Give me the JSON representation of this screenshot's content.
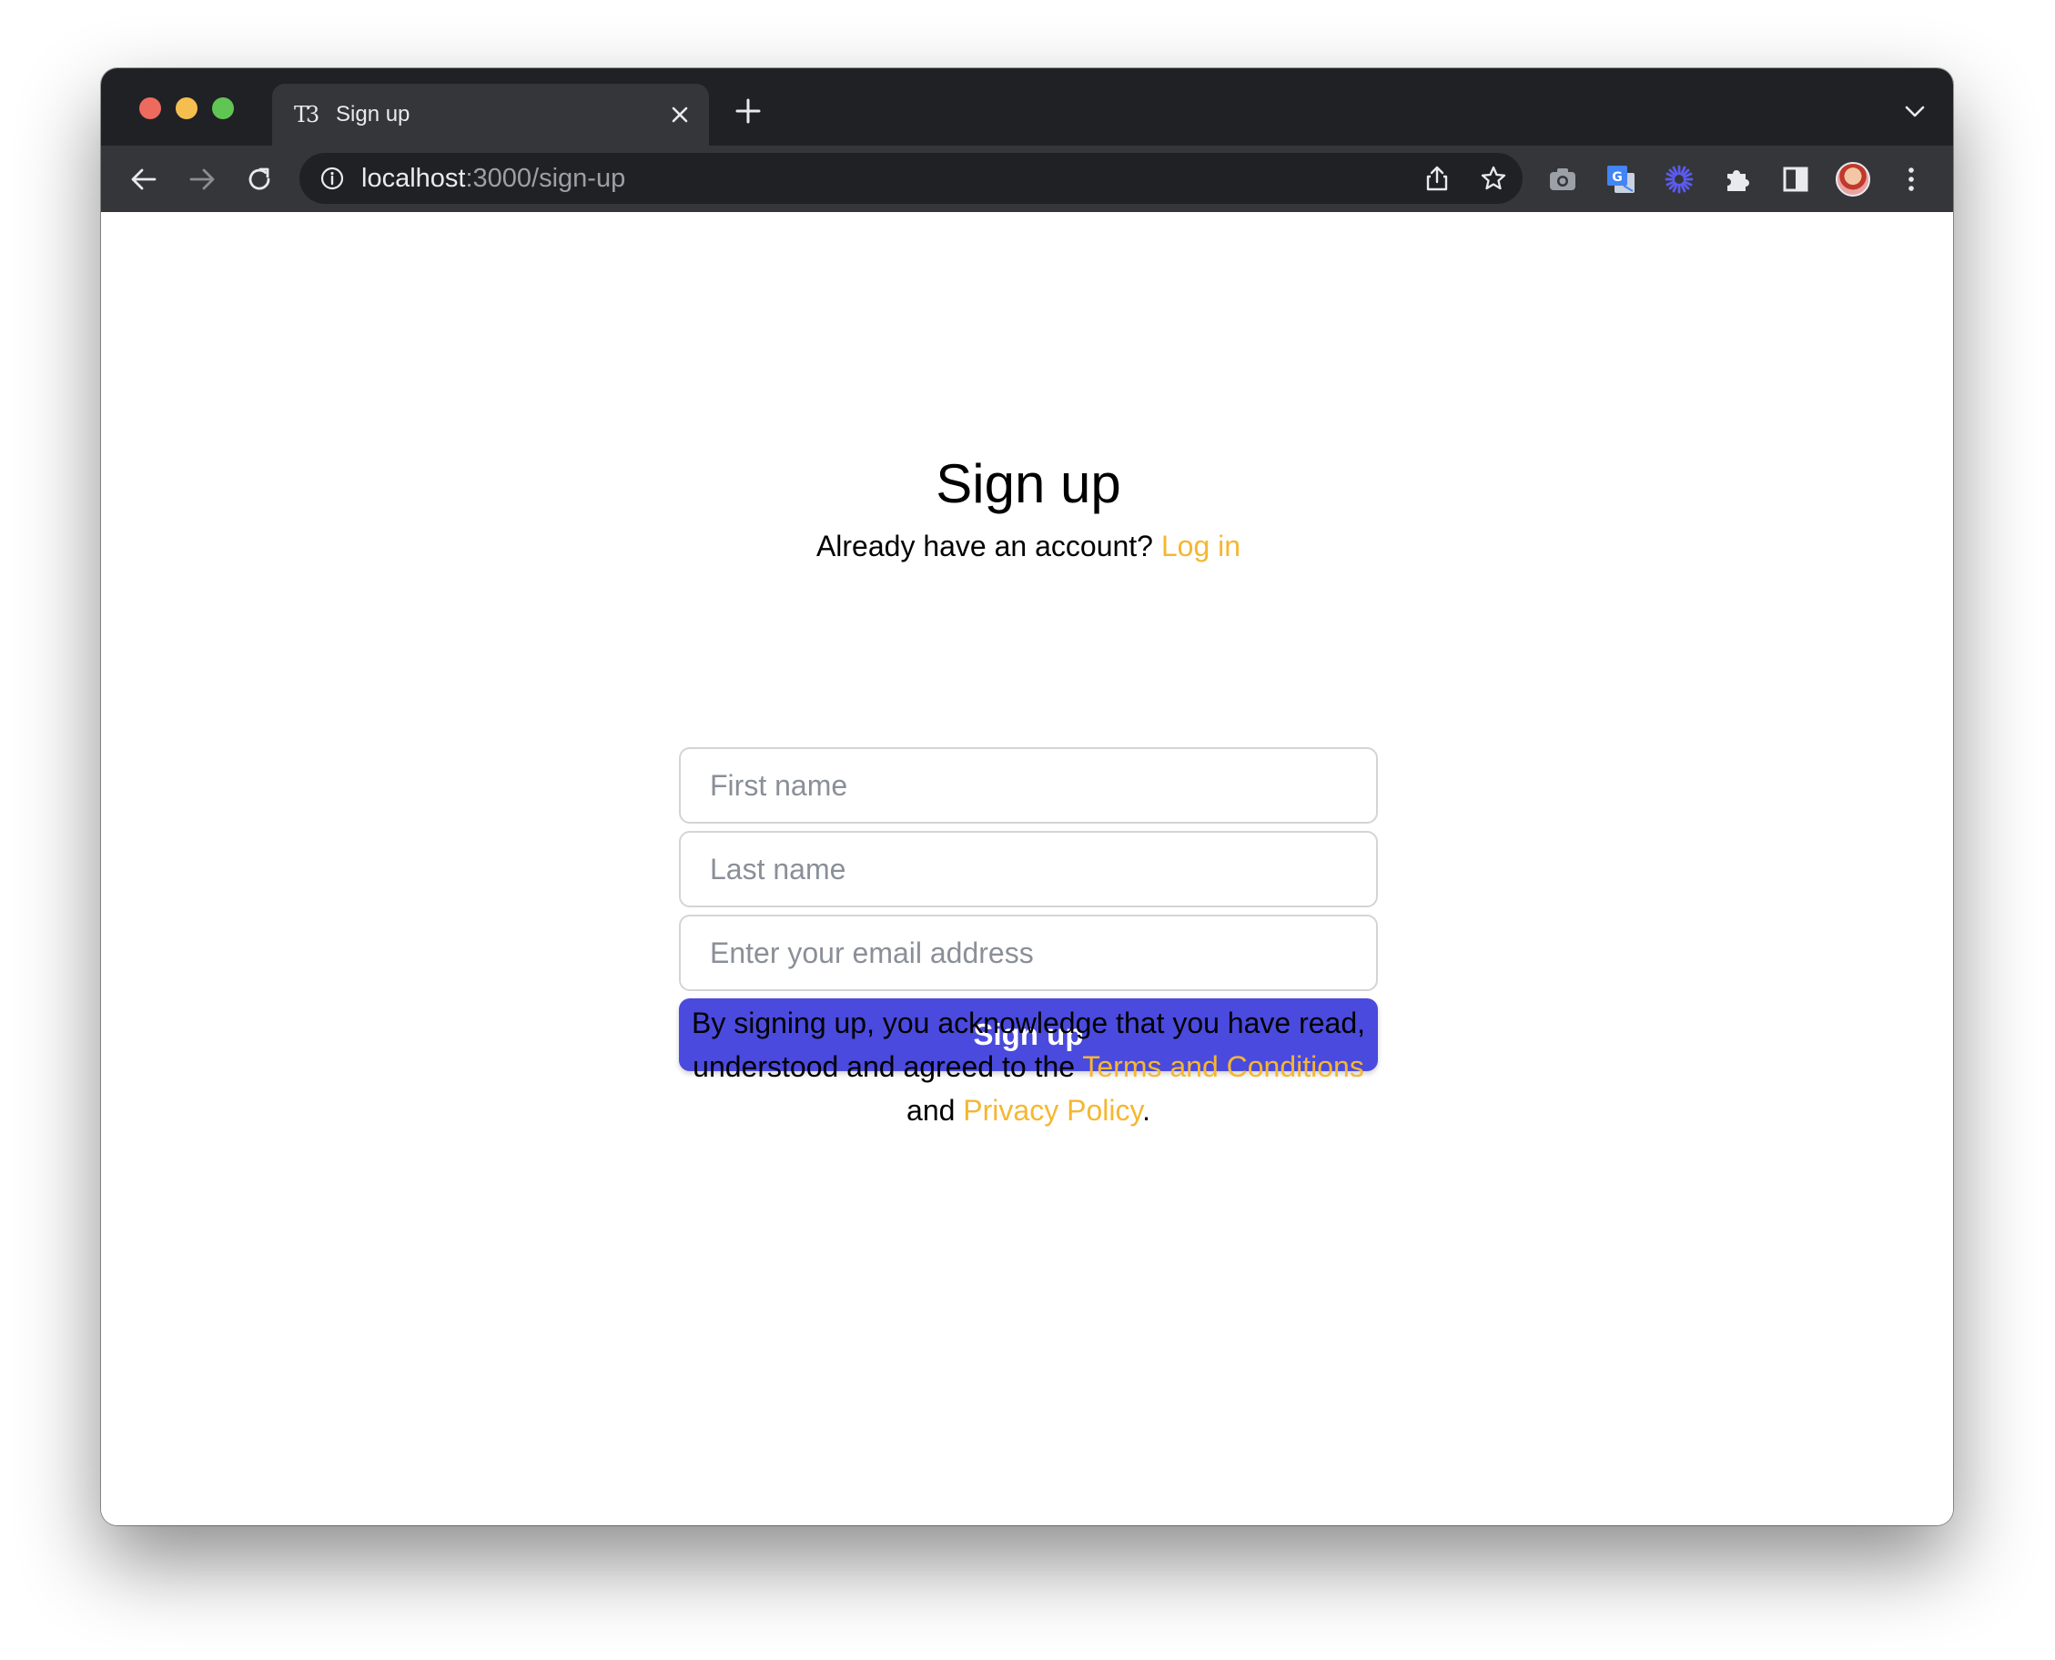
{
  "browser": {
    "tab_title": "Sign up",
    "tab_favicon": "T3",
    "url_host": "localhost",
    "url_path": ":3000/sign-up",
    "icons": [
      "back-arrow-icon",
      "forward-arrow-icon",
      "reload-icon",
      "info-icon",
      "share-icon",
      "star-icon",
      "camera-icon",
      "translate-icon",
      "snowflake-icon",
      "puzzle-icon",
      "side-panel-icon",
      "menu-dots-icon"
    ]
  },
  "page": {
    "heading": "Sign up",
    "subtext_prefix": "Already have an account?",
    "login_link": "Log in",
    "fields": {
      "first_name_placeholder": "First name",
      "last_name_placeholder": "Last name",
      "email_placeholder": "Enter your email address"
    },
    "submit_label": "Sign up",
    "legal": {
      "line1": "By signing up, you acknowledge that you have read,",
      "line2_prefix": "understood and agreed to the",
      "terms_link": "Terms and Conditions",
      "line3_prefix": "and",
      "privacy_link": "Privacy Policy",
      "line3_suffix": "."
    }
  },
  "colors": {
    "accent_link": "#f5b731",
    "primary_button": "#4a4ade",
    "browser_dark": "#202124"
  }
}
